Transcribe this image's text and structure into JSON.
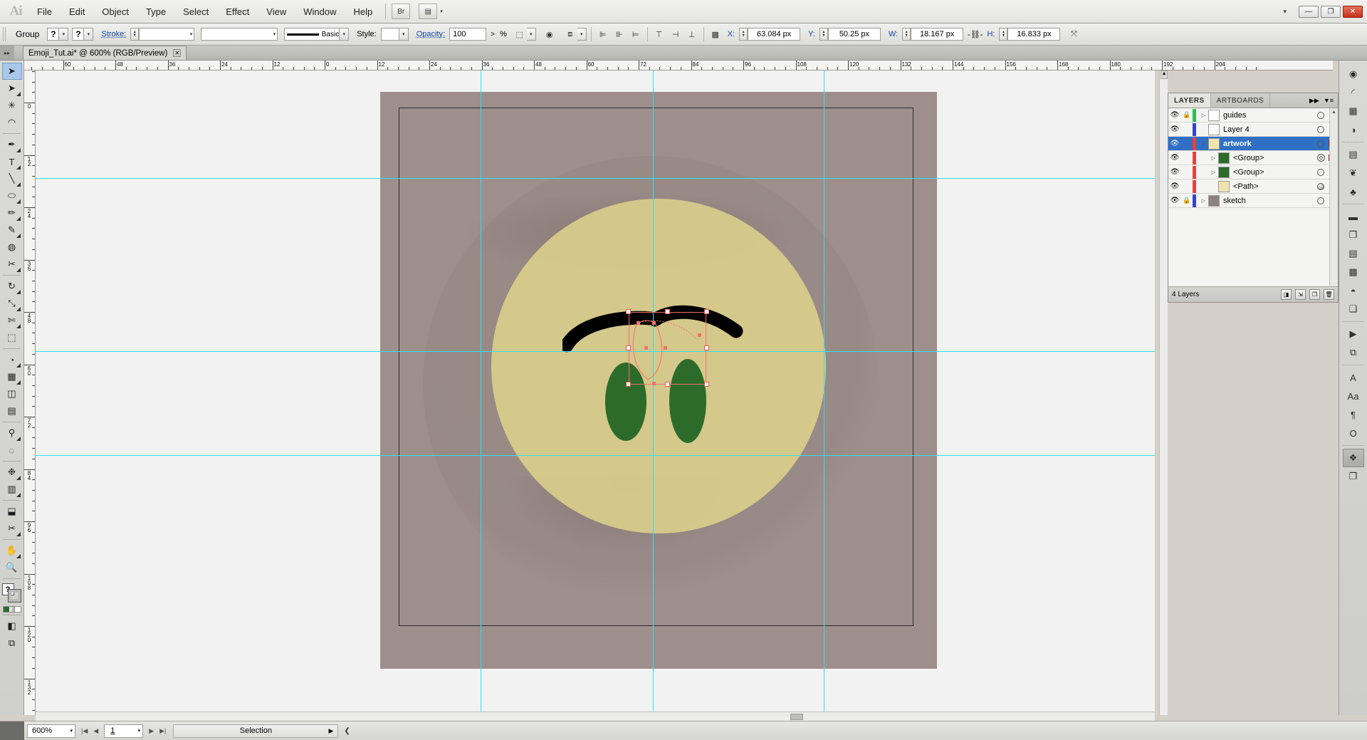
{
  "app": {
    "logo": "Ai",
    "menu": [
      "File",
      "Edit",
      "Object",
      "Type",
      "Select",
      "Effect",
      "View",
      "Window",
      "Help"
    ],
    "bridge_icon": "br-icon",
    "arrange_icon": "arrange-documents-icon",
    "window_dropdown": "▾",
    "window_minimize": "—",
    "window_restore": "❐",
    "window_close": "✕"
  },
  "control_bar": {
    "selection_label": "Group",
    "fill_swatch": "?",
    "stroke_swatch": "?",
    "stroke_link": "Stroke:",
    "stroke_weight": "",
    "brush_definition": "",
    "stroke_profile_label": "Basic",
    "style_label": "Style:",
    "style_value": "",
    "opacity_label": "Opacity:",
    "opacity_value": "100",
    "opacity_unit": "%",
    "opacity_more": ">",
    "x_label": "X:",
    "x_value": "63.084 px",
    "y_label": "Y:",
    "y_value": "50.25 px",
    "w_label": "W:",
    "w_value": "18.167 px",
    "h_label": "H:",
    "h_value": "16.833 px",
    "lock_ratio_icon": "link-icon",
    "transform_icon": "transform-icon",
    "isolate_icon": "isolate-selected-icon",
    "mask_icon": "make-clipping-mask-icon",
    "align_left_icon": "align-left-icon",
    "align_center_icon": "align-center-icon",
    "align_right_icon": "align-right-icon",
    "distribute_top_icon": "distribute-top-icon",
    "distribute_mid_icon": "distribute-middle-icon",
    "distribute_bot_icon": "distribute-bottom-icon",
    "transform_panel_icon": "transform-panel-icon"
  },
  "document_tab": {
    "title": "Emoji_Tut.ai* @ 600% (RGB/Preview)",
    "close": "✕"
  },
  "tools": [
    {
      "name": "selection-tool",
      "glyph": "➤",
      "selected": true,
      "hidden_more": false
    },
    {
      "name": "direct-selection-tool",
      "glyph": "➤",
      "selected": false,
      "hidden_more": true
    },
    {
      "name": "magic-wand-tool",
      "glyph": "✳",
      "selected": false,
      "hidden_more": false
    },
    {
      "name": "lasso-tool",
      "glyph": "◠",
      "selected": false,
      "hidden_more": false
    },
    {
      "name": "pen-tool",
      "glyph": "✒",
      "selected": false,
      "hidden_more": true
    },
    {
      "name": "type-tool",
      "glyph": "T",
      "selected": false,
      "hidden_more": true
    },
    {
      "name": "line-segment-tool",
      "glyph": "╲",
      "selected": false,
      "hidden_more": true
    },
    {
      "name": "ellipse-tool",
      "glyph": "⬭",
      "selected": false,
      "hidden_more": true
    },
    {
      "name": "paintbrush-tool",
      "glyph": "✏",
      "selected": false,
      "hidden_more": true
    },
    {
      "name": "pencil-tool",
      "glyph": "✎",
      "selected": false,
      "hidden_more": true
    },
    {
      "name": "blob-brush-tool",
      "glyph": "◍",
      "selected": false,
      "hidden_more": false
    },
    {
      "name": "eraser-tool",
      "glyph": "✂",
      "selected": false,
      "hidden_more": true
    },
    {
      "name": "rotate-tool",
      "glyph": "↻",
      "selected": false,
      "hidden_more": true
    },
    {
      "name": "scale-tool",
      "glyph": "⤡",
      "selected": false,
      "hidden_more": true
    },
    {
      "name": "width-tool",
      "glyph": "✄",
      "selected": false,
      "hidden_more": true
    },
    {
      "name": "free-transform-tool",
      "glyph": "⬚",
      "selected": false,
      "hidden_more": false
    },
    {
      "name": "shape-builder-tool",
      "glyph": "◔",
      "selected": false,
      "hidden_more": true
    },
    {
      "name": "perspective-grid-tool",
      "glyph": "▦",
      "selected": false,
      "hidden_more": true
    },
    {
      "name": "mesh-tool",
      "glyph": "◫",
      "selected": false,
      "hidden_more": false
    },
    {
      "name": "gradient-tool",
      "glyph": "▤",
      "selected": false,
      "hidden_more": false
    },
    {
      "name": "eyedropper-tool",
      "glyph": "⚲",
      "selected": false,
      "hidden_more": true
    },
    {
      "name": "blend-tool",
      "glyph": "◌",
      "selected": false,
      "hidden_more": false
    },
    {
      "name": "symbol-sprayer-tool",
      "glyph": "❉",
      "selected": false,
      "hidden_more": true
    },
    {
      "name": "column-graph-tool",
      "glyph": "▥",
      "selected": false,
      "hidden_more": true
    },
    {
      "name": "artboard-tool",
      "glyph": "⬓",
      "selected": false,
      "hidden_more": false
    },
    {
      "name": "slice-tool",
      "glyph": "✂",
      "selected": false,
      "hidden_more": true
    },
    {
      "name": "hand-tool",
      "glyph": "✋",
      "selected": false,
      "hidden_more": true
    },
    {
      "name": "zoom-tool",
      "glyph": "🔍",
      "selected": false,
      "hidden_more": false
    }
  ],
  "tool_extras": {
    "fill_stroke_icon": "fill-and-stroke-swatches",
    "swap_icon": "swap-fill-stroke-icon",
    "default_icon": "default-fill-stroke-icon",
    "color_mode_icons": [
      "color-swatch",
      "gradient-swatch",
      "none-swatch"
    ],
    "screen_mode_icon": "change-screen-mode-icon",
    "drawing_mode_icon": "drawing-mode-icon",
    "fill_color": "#2d6b2b",
    "stroke_color": "#000000"
  },
  "rulers": {
    "horizontal_labels": [
      "84",
      "72",
      "60",
      "48",
      "36",
      "24",
      "12",
      "0",
      "12",
      "24",
      "36",
      "48",
      "60",
      "72",
      "84",
      "96",
      "108",
      "120",
      "132",
      "144",
      "156",
      "168",
      "180",
      "192",
      "204"
    ],
    "vertical_labels": [
      "24",
      "0",
      "12",
      "24",
      "36",
      "48",
      "60",
      "72",
      "84",
      "96",
      "108",
      "120",
      "132"
    ],
    "unit": "px"
  },
  "canvas": {
    "zoom": "600%",
    "artboard_title": "",
    "face_color": "#d9cd8b",
    "eye_color": "#2d6b2b",
    "brow_color": "#000000",
    "sketch_color": "#9e8f8c",
    "guide_color": "#31e0ef",
    "selection_color": "#f1726a"
  },
  "layers_panel": {
    "tabs": [
      {
        "label": "LAYERS",
        "active": true
      },
      {
        "label": "ARTBOARDS",
        "active": false
      }
    ],
    "collapse_icon": "▶▶",
    "menu_icon": "▼≡",
    "rows": [
      {
        "name": "guides",
        "indent": 0,
        "visible": true,
        "locked": true,
        "color": "#2ebf4f",
        "has_triangle": true,
        "thumb": "#ffffff",
        "target": "circle",
        "selected": false,
        "sq": null
      },
      {
        "name": "Layer 4",
        "indent": 0,
        "visible": true,
        "locked": false,
        "color": "#3344cc",
        "has_triangle": false,
        "thumb": "#ffffff",
        "target": "circle",
        "selected": false,
        "sq": null
      },
      {
        "name": "artwork",
        "indent": 0,
        "visible": true,
        "locked": false,
        "color": "#e0443e",
        "has_triangle": true,
        "thumb": "#efe3b0",
        "target": "circle",
        "selected": true,
        "sq": "#f06a62"
      },
      {
        "name": "<Group>",
        "indent": 1,
        "visible": true,
        "locked": false,
        "color": "#e0443e",
        "has_triangle": true,
        "thumb": "#2d6b2b",
        "target": "double",
        "selected": false,
        "sq": "#ee2b22"
      },
      {
        "name": "<Group>",
        "indent": 1,
        "visible": true,
        "locked": false,
        "color": "#e0443e",
        "has_triangle": true,
        "thumb": "#2d6b2b",
        "target": "circle",
        "selected": false,
        "sq": null
      },
      {
        "name": "<Path>",
        "indent": 1,
        "visible": true,
        "locked": false,
        "color": "#e0443e",
        "has_triangle": false,
        "thumb": "#efe3b0",
        "target": "filled",
        "selected": false,
        "sq": null
      },
      {
        "name": "sketch",
        "indent": 0,
        "visible": true,
        "locked": true,
        "color": "#3344cc",
        "has_triangle": true,
        "thumb": "#8d8280",
        "target": "circle",
        "selected": false,
        "sq": null
      }
    ],
    "footer_count": "4 Layers",
    "footer_icons": [
      "make-clipping-mask-icon",
      "create-new-sublayer-icon",
      "create-new-layer-icon",
      "delete-selection-icon"
    ],
    "eye_icon": "eye-icon",
    "lock_icon": "lock-icon"
  },
  "icon_rail": [
    {
      "name": "color-panel-icon",
      "glyph": "◉"
    },
    {
      "name": "color-guide-panel-icon",
      "glyph": "◜"
    },
    {
      "name": "swatches-panel-icon",
      "glyph": "▦"
    },
    {
      "name": "transparency-panel-icon",
      "glyph": "◑"
    },
    {
      "name": "gradient-panel-icon",
      "glyph": "▤"
    },
    {
      "name": "brushes-panel-icon",
      "glyph": "❦"
    },
    {
      "name": "symbols-panel-icon",
      "glyph": "♣"
    },
    {
      "name": "stroke-panel-icon",
      "glyph": "▬"
    },
    {
      "name": "pathfinder-panel-icon",
      "glyph": "❐"
    },
    {
      "name": "align-panel-icon",
      "glyph": "▤"
    },
    {
      "name": "image-trace-panel-icon",
      "glyph": "▩"
    },
    {
      "name": "appearance-panel-icon",
      "glyph": "◓"
    },
    {
      "name": "graphic-styles-panel-icon",
      "glyph": "❏"
    },
    {
      "name": "actions-panel-icon",
      "glyph": "▶"
    },
    {
      "name": "links-panel-icon",
      "glyph": "⧉"
    },
    {
      "name": "character-panel-icon",
      "glyph": "A"
    },
    {
      "name": "character-styles-panel-icon",
      "glyph": "Aa"
    },
    {
      "name": "paragraph-panel-icon",
      "glyph": "¶"
    },
    {
      "name": "open-type-panel-icon",
      "glyph": "O"
    },
    {
      "name": "layers-panel-icon",
      "glyph": "❖"
    },
    {
      "name": "artboards-panel-icon",
      "glyph": "❐"
    }
  ],
  "status_bar": {
    "zoom_value": "600%",
    "zoom_arrow": "▾",
    "nav_first": "|◀",
    "nav_prev": "◀",
    "page_value": "1",
    "page_arrow": "▾",
    "nav_next": "▶",
    "nav_last": "▶|",
    "status_text": "Selection",
    "status_arrow": "▶",
    "chevron": "❮"
  }
}
